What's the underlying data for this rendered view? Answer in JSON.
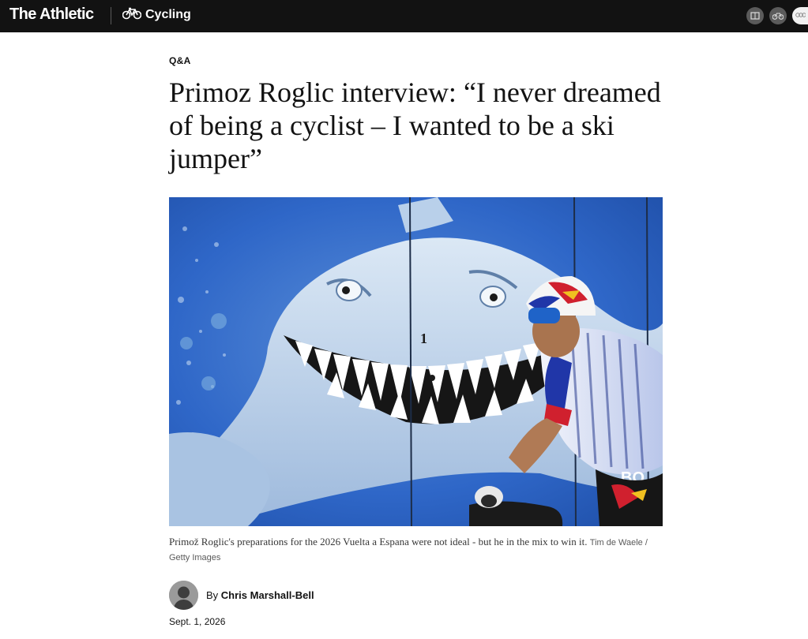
{
  "header": {
    "brand": "The Athletic",
    "section_label": "Cycling",
    "icons": [
      "scoreboard-icon",
      "bicycle-icon",
      "olympics-icon"
    ]
  },
  "article": {
    "kicker": "Q&A",
    "headline": "Primoz Roglic interview: “I never dreamed of being a cyclist – I wanted to be a ski jumper”",
    "image": {
      "description_icon": "shark-mural-cyclist-photo",
      "mural_number": "1",
      "jersey_text": "BO"
    },
    "caption": "Primož Roglic's preparations for the 2026 Vuelta a Espana were not ideal - but he in the mix to win it.",
    "credit": "Tim de Waele / Getty Images",
    "byline_prefix": "By",
    "author": "Chris Marshall-Bell",
    "date": "Sept. 1, 2026"
  },
  "colors": {
    "topbar": "#121212",
    "mural_blue": "#2f67c8",
    "shark_light": "#c9dced",
    "jersey_red": "#d0202e"
  }
}
